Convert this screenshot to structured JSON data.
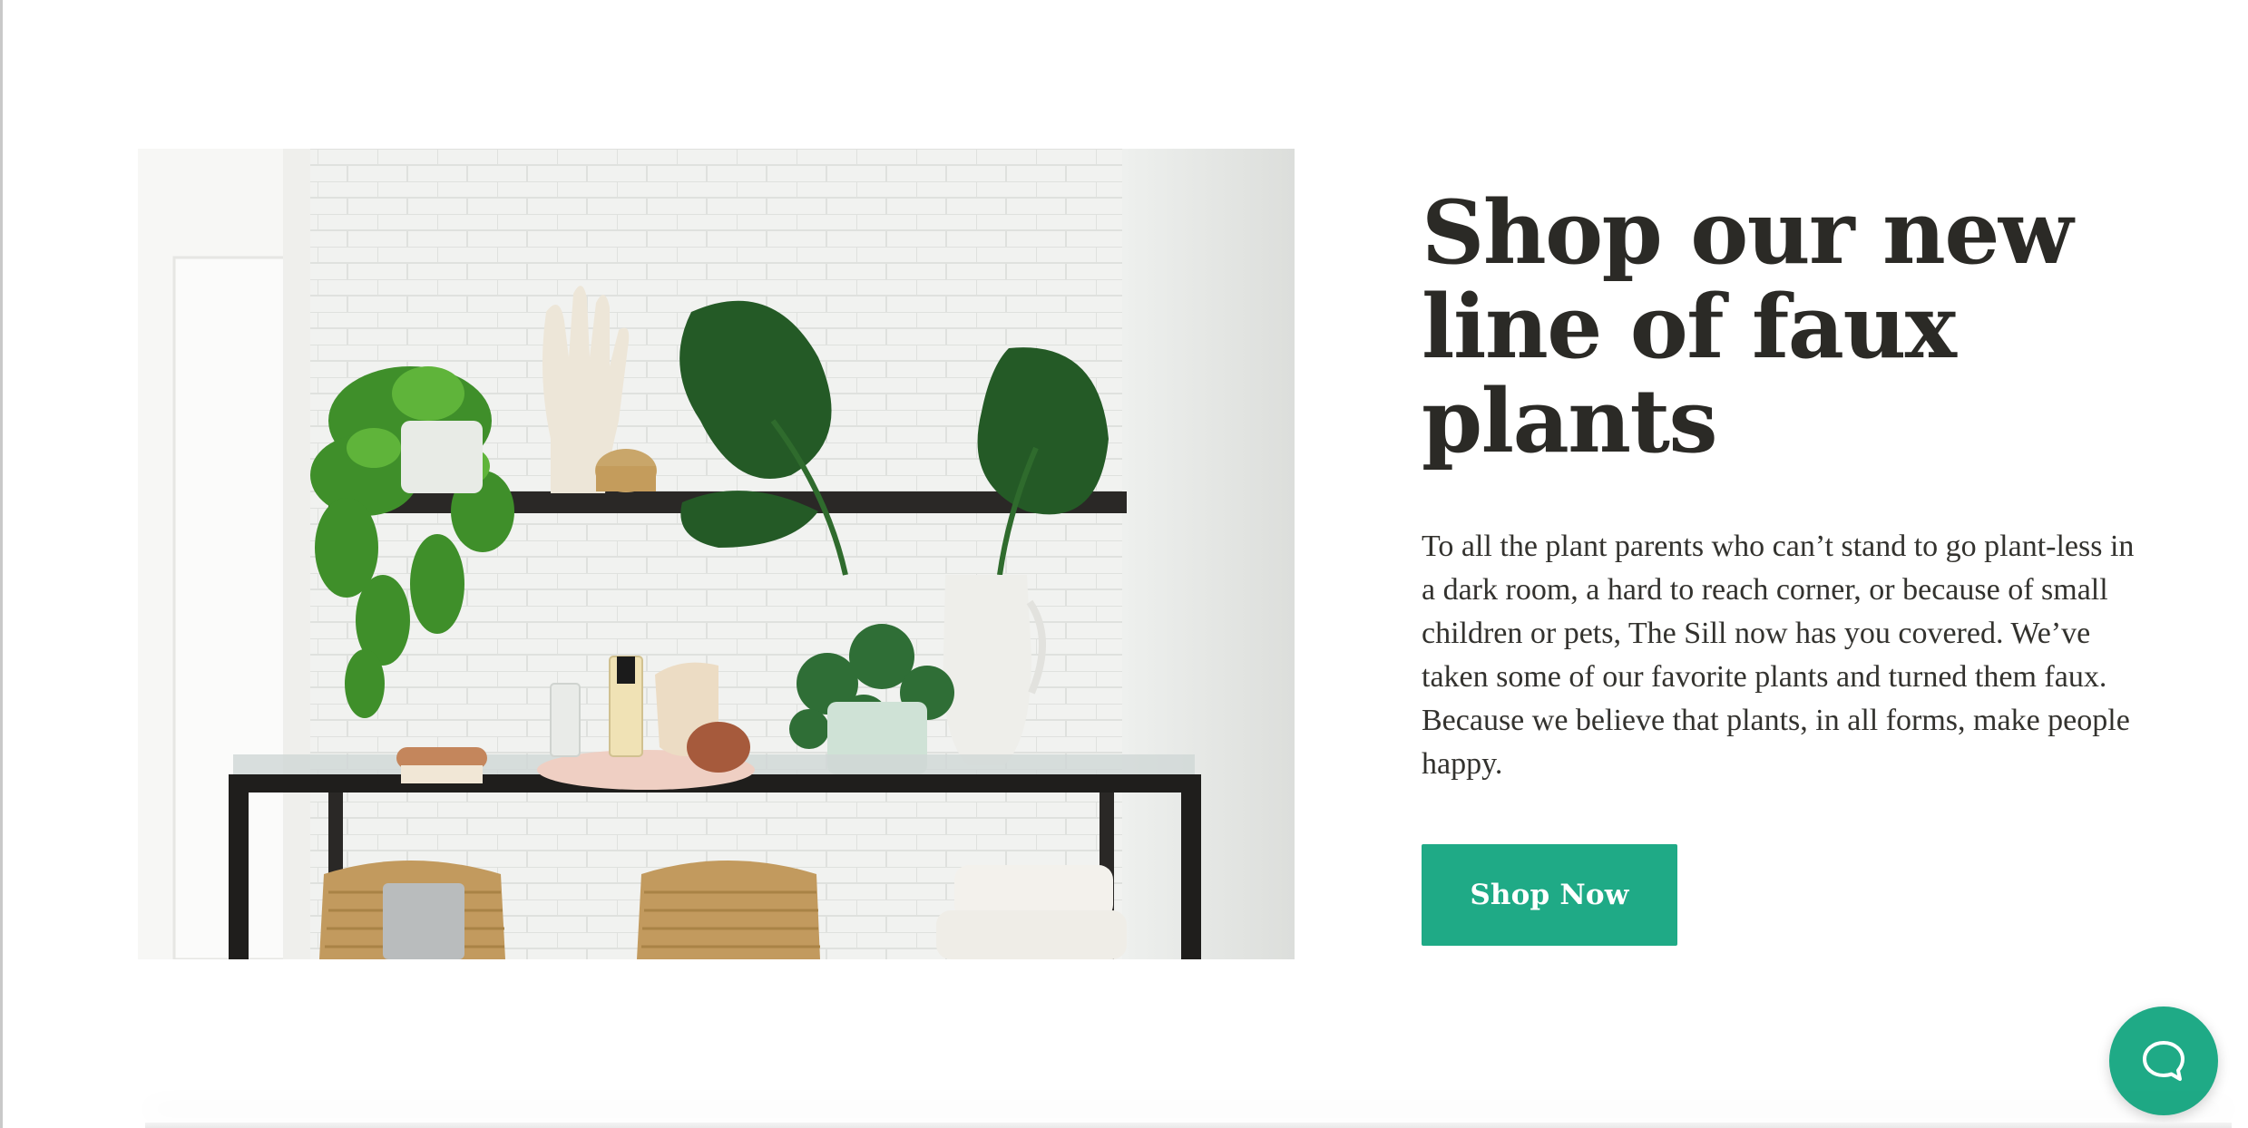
{
  "hero": {
    "image_alt": "Faux plants on a black metal shelf against white subway tile",
    "headline": "Shop our new line of faux plants",
    "body": "To all the plant parents who can’t stand to go plant-less in a dark room, a hard to reach corner, or because of small children or pets, The Sill now has you covered. We’ve taken some of our favorite plants and turned them faux. Because we believe that plants, in all forms, make people happy.",
    "cta_label": "Shop Now"
  },
  "chat": {
    "icon": "chat-bubble-icon"
  },
  "colors": {
    "accent": "#1faa86",
    "text": "#2b2a26",
    "background": "#ffffff"
  }
}
